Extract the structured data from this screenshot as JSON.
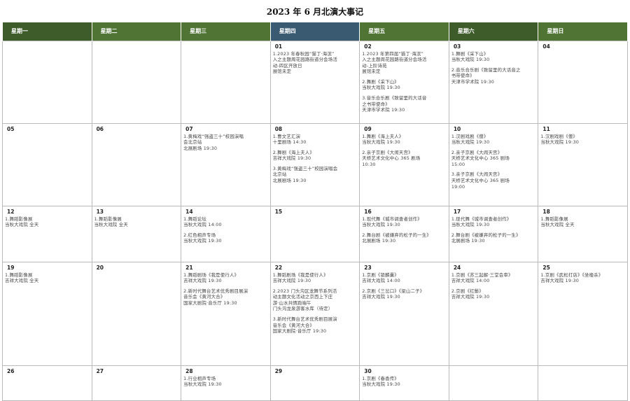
{
  "title": "2023 年 6 月北演大事记",
  "weekdays": [
    "星期一",
    "星期二",
    "星期三",
    "星期四",
    "星期五",
    "星期六",
    "星期日"
  ],
  "weeks": [
    [
      {
        "day": "",
        "events": []
      },
      {
        "day": "",
        "events": []
      },
      {
        "day": "",
        "events": []
      },
      {
        "day": "01",
        "events": [
          "1.2023 年春秋园“猫丁·海滨”\n入之主题周花园路街道分会场活\n动-四区开放日\n展馆未定"
        ]
      },
      {
        "day": "02",
        "events": [
          "1.2023 年第四届“猫丁·海滨”\n入之主题周花园路街道分会场活\n动-上阶诗苑\n展馆未定",
          "2.舞剧《采下山》\n当秋大戏院 19:30",
          "3.音乐合乐剧《致留里的大话音\n之书带使命》\n天津市学术院 19:30"
        ]
      },
      {
        "day": "03",
        "events": [
          "1.舞剧《采下山》\n当秋大戏院 19:30",
          "2.音乐合乐剧《致留里的大话音之\n书带使命》\n天津市学术院 19:30"
        ]
      },
      {
        "day": "04",
        "events": []
      }
    ],
    [
      {
        "day": "05",
        "events": []
      },
      {
        "day": "06",
        "events": []
      },
      {
        "day": "07",
        "events": [
          "1.黄梅戏“强盗三十”校园演唱\n会北京站\n北展剧场 19:30"
        ]
      },
      {
        "day": "08",
        "events": [
          "1.曹文艺汇演\n十里剧场 14:30",
          "2.舞剧《海上夫人》\n吉祥大戏院 19:30",
          "3.黄梅戏“强盗三十”校园演唱会\n北京站\n北展剧场 19:30"
        ]
      },
      {
        "day": "09",
        "events": [
          "1.舞剧《海上夫人》\n当秋大戏院 19:30",
          "2.亲子京剧《大闹天宫》\n天桥艺术文化中心 365 剧场\n10:30"
        ]
      },
      {
        "day": "10",
        "events": [
          "1.汉剧戏剧《僧》\n当秋大戏院 19:30",
          "2.亲子京剧《大闹天宫》\n天桥艺术文化中心 365 剧场\n15:00",
          "3.亲子京剧《大闹天宫》\n天桥艺术文化中心 365 剧场\n19:00"
        ]
      },
      {
        "day": "11",
        "events": [
          "1.汉剧戏剧《僧》\n当秋大戏院 19:30"
        ]
      }
    ],
    [
      {
        "day": "12",
        "events": [
          "1.舞蹈影像展\n当秋大戏院 全天"
        ]
      },
      {
        "day": "13",
        "events": [
          "1.舞蹈影像展\n当秋大戏院 全天"
        ]
      },
      {
        "day": "14",
        "events": [
          "1.舞蹈论坛\n当秋大戏院 14:00",
          "2.红色相声专场\n当秋大戏院 19:30"
        ]
      },
      {
        "day": "15",
        "events": []
      },
      {
        "day": "16",
        "events": [
          "1.现代舞《城市调查者创作》\n当秋大戏院 19:30",
          "2.舞台剧《被嫌弃的松子的一生》\n北展剧场 19:30"
        ]
      },
      {
        "day": "17",
        "events": [
          "1.现代舞《城市调查者创作》\n当秋大戏院 19:30",
          "2.舞台剧《被嫌弃的松子的一生》\n北展剧场 19:30"
        ]
      },
      {
        "day": "18",
        "events": [
          "1.舞蹈影像展\n当秋大戏院 全天"
        ]
      }
    ],
    [
      {
        "day": "19",
        "events": [
          "1.舞蹈影像展\n吉祥大戏院 全天"
        ]
      },
      {
        "day": "20",
        "events": []
      },
      {
        "day": "21",
        "events": [
          "1.舞蹈剧场《我是使行人》\n吉祥大戏院 19:30",
          "2.新时代舞台艺术优秀剧目展演\n音乐会《黄河大合》\n国家大剧院·音乐厅 19:30"
        ]
      },
      {
        "day": "22",
        "events": [
          "1.舞蹈剧场《我是使行人》\n吉祥大戏院 19:30",
          "2.2023 门头沟区龙舞节系列活\n动主题文化活动之京西上下庄\n游·山水共情跑端午\n门头沟龙泉游客水库（待定）",
          "3.新时代舞台艺术优秀剧目展演\n音乐会《黄河大合》\n国家大剧院·音乐厅 19:30"
        ]
      },
      {
        "day": "23",
        "events": [
          "1.京剧《锁麟囊》\n吉祥大戏院 14:00",
          "2.京剧《三岔口》《梁山二子》\n吉祥大戏院 19:30"
        ]
      },
      {
        "day": "24",
        "events": [
          "1.京剧《苏三起解·三堂会审》\n吉祥大戏院 14:00",
          "2.京剧《红鬃》\n吉祥大戏院 19:30"
        ]
      },
      {
        "day": "25",
        "events": [
          "1.京剧《武松打店》《坐楼杀》\n吉祥大戏院 19:30"
        ]
      }
    ],
    [
      {
        "day": "26",
        "events": []
      },
      {
        "day": "27",
        "events": []
      },
      {
        "day": "28",
        "events": [
          "1.行业相声专场\n当秋大戏院 19:30"
        ]
      },
      {
        "day": "29",
        "events": []
      },
      {
        "day": "30",
        "events": [
          "1.京剧《春香传》\n当秋大戏院 19:30"
        ]
      },
      {
        "day": "",
        "events": []
      },
      {
        "day": "",
        "events": []
      }
    ]
  ],
  "colors": {
    "header_dark": "#3d5c2a",
    "header_med": "#4f7434",
    "header_blue": "#3a5a72",
    "grid": "#b9b9b9"
  }
}
